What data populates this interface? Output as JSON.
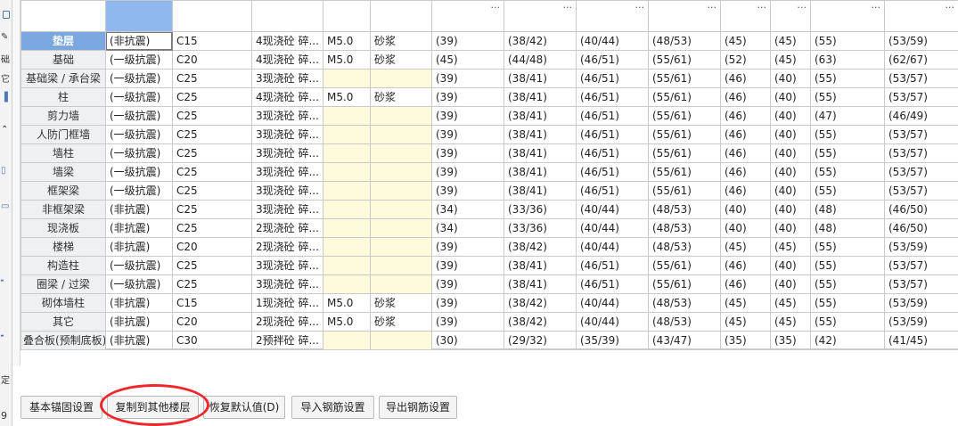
{
  "left_strip": {
    "glyphs": [
      "础",
      "它",
      "定"
    ],
    "status_digit": "9"
  },
  "grid": {
    "header_cells": [
      "",
      "",
      "",
      "",
      "",
      "",
      "...",
      "...",
      "...",
      "...",
      "...",
      "...",
      "...",
      "..."
    ],
    "rows": [
      {
        "name": "垫层",
        "grade": "(非抗震)",
        "concrete": "C15",
        "type": "4现浇砼 碎...",
        "mortar": "M5.0",
        "mortar_type": "砂浆",
        "values": [
          "(39)",
          "(38/42)",
          "(40/44)",
          "(48/53)",
          "(45)",
          "(45)",
          "(55)",
          "(53/59)"
        ]
      },
      {
        "name": "基础",
        "grade": "(一级抗震)",
        "concrete": "C20",
        "type": "4现浇砼 碎...",
        "mortar": "M5.0",
        "mortar_type": "砂浆",
        "values": [
          "(45)",
          "(44/48)",
          "(46/51)",
          "(55/61)",
          "(52)",
          "(45)",
          "(63)",
          "(62/67)"
        ]
      },
      {
        "name": "基础梁 / 承台梁",
        "grade": "(一级抗震)",
        "concrete": "C25",
        "type": "3现浇砼 碎...",
        "mortar": "",
        "mortar_type": "",
        "values": [
          "(39)",
          "(38/41)",
          "(46/51)",
          "(55/61)",
          "(46)",
          "(40)",
          "(55)",
          "(53/57)"
        ]
      },
      {
        "name": "柱",
        "grade": "(一级抗震)",
        "concrete": "C25",
        "type": "4现浇砼 碎...",
        "mortar": "M5.0",
        "mortar_type": "砂浆",
        "values": [
          "(39)",
          "(38/41)",
          "(46/51)",
          "(55/61)",
          "(46)",
          "(40)",
          "(55)",
          "(53/57)"
        ]
      },
      {
        "name": "剪力墙",
        "grade": "(一级抗震)",
        "concrete": "C25",
        "type": "3现浇砼 碎...",
        "mortar": "",
        "mortar_type": "",
        "values": [
          "(39)",
          "(38/41)",
          "(46/51)",
          "(55/61)",
          "(46)",
          "(40)",
          "(47)",
          "(46/49)"
        ]
      },
      {
        "name": "人防门框墙",
        "grade": "(一级抗震)",
        "concrete": "C25",
        "type": "3现浇砼 碎...",
        "mortar": "",
        "mortar_type": "",
        "values": [
          "(39)",
          "(38/41)",
          "(46/51)",
          "(55/61)",
          "(46)",
          "(40)",
          "(55)",
          "(53/57)"
        ]
      },
      {
        "name": "墙柱",
        "grade": "(一级抗震)",
        "concrete": "C25",
        "type": "3现浇砼 碎...",
        "mortar": "",
        "mortar_type": "",
        "values": [
          "(39)",
          "(38/41)",
          "(46/51)",
          "(55/61)",
          "(46)",
          "(40)",
          "(55)",
          "(53/57)"
        ]
      },
      {
        "name": "墙梁",
        "grade": "(一级抗震)",
        "concrete": "C25",
        "type": "3现浇砼 碎...",
        "mortar": "",
        "mortar_type": "",
        "values": [
          "(39)",
          "(38/41)",
          "(46/51)",
          "(55/61)",
          "(46)",
          "(40)",
          "(55)",
          "(53/57)"
        ]
      },
      {
        "name": "框架梁",
        "grade": "(一级抗震)",
        "concrete": "C25",
        "type": "3现浇砼 碎...",
        "mortar": "",
        "mortar_type": "",
        "values": [
          "(39)",
          "(38/41)",
          "(46/51)",
          "(55/61)",
          "(46)",
          "(40)",
          "(55)",
          "(53/57)"
        ]
      },
      {
        "name": "非框架梁",
        "grade": "(非抗震)",
        "concrete": "C25",
        "type": "3现浇砼 碎...",
        "mortar": "",
        "mortar_type": "",
        "values": [
          "(34)",
          "(33/36)",
          "(40/44)",
          "(48/53)",
          "(40)",
          "(40)",
          "(48)",
          "(46/50)"
        ]
      },
      {
        "name": "现浇板",
        "grade": "(非抗震)",
        "concrete": "C25",
        "type": "2现浇砼 碎...",
        "mortar": "",
        "mortar_type": "",
        "values": [
          "(34)",
          "(33/36)",
          "(40/44)",
          "(48/53)",
          "(40)",
          "(40)",
          "(48)",
          "(46/50)"
        ]
      },
      {
        "name": "楼梯",
        "grade": "(非抗震)",
        "concrete": "C20",
        "type": "2现浇砼 碎...",
        "mortar": "",
        "mortar_type": "",
        "values": [
          "(39)",
          "(38/42)",
          "(40/44)",
          "(48/53)",
          "(45)",
          "(45)",
          "(55)",
          "(53/59)"
        ]
      },
      {
        "name": "构造柱",
        "grade": "(一级抗震)",
        "concrete": "C25",
        "type": "3现浇砼 碎...",
        "mortar": "",
        "mortar_type": "",
        "values": [
          "(39)",
          "(38/41)",
          "(46/51)",
          "(55/61)",
          "(46)",
          "(40)",
          "(55)",
          "(53/57)"
        ]
      },
      {
        "name": "圈梁 / 过梁",
        "grade": "(一级抗震)",
        "concrete": "C25",
        "type": "3现浇砼 碎...",
        "mortar": "",
        "mortar_type": "",
        "values": [
          "(39)",
          "(38/41)",
          "(46/51)",
          "(55/61)",
          "(46)",
          "(40)",
          "(55)",
          "(53/57)"
        ]
      },
      {
        "name": "砌体墙柱",
        "grade": "(非抗震)",
        "concrete": "C15",
        "type": "1现浇砼 碎...",
        "mortar": "M5.0",
        "mortar_type": "砂浆",
        "values": [
          "(39)",
          "(38/42)",
          "(40/44)",
          "(48/53)",
          "(45)",
          "(45)",
          "(55)",
          "(53/59)"
        ]
      },
      {
        "name": "其它",
        "grade": "(非抗震)",
        "concrete": "C20",
        "type": "2现浇砼 碎...",
        "mortar": "M5.0",
        "mortar_type": "砂浆",
        "values": [
          "(39)",
          "(38/42)",
          "(40/44)",
          "(48/53)",
          "(45)",
          "(45)",
          "(55)",
          "(53/59)"
        ]
      },
      {
        "name": "叠合板(预制底板)",
        "grade": "(非抗震)",
        "concrete": "C30",
        "type": "2预拌砼 碎...",
        "mortar": "",
        "mortar_type": "",
        "values": [
          "(30)",
          "(29/32)",
          "(35/39)",
          "(43/47)",
          "(35)",
          "(35)",
          "(42)",
          "(41/45)"
        ]
      }
    ]
  },
  "buttons": {
    "basic_anchor": "基本锚固设置",
    "copy_to_floors": "复制到其他楼层",
    "restore_default": "恢复默认值(D)",
    "import_rebar": "导入钢筋设置",
    "export_rebar": "导出钢筋设置"
  }
}
